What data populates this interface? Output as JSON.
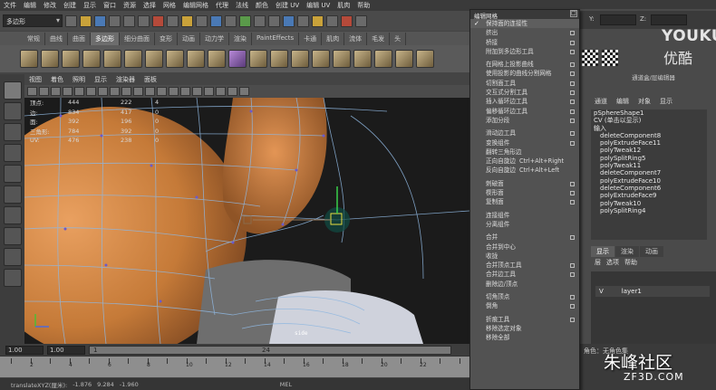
{
  "menubar": [
    "文件",
    "编辑",
    "修改",
    "创建",
    "显示",
    "窗口",
    "资源",
    "选择",
    "网格",
    "编辑网格",
    "代理",
    "法线",
    "颜色",
    "创建 UV",
    "编辑 UV",
    "肌肉",
    "帮助"
  ],
  "status_line": {
    "mode_select": "多边形"
  },
  "shelf_tabs": [
    "常规",
    "曲线",
    "曲面",
    "多边形",
    "细分曲面",
    "变形",
    "动画",
    "动力学",
    "渲染",
    "PaintEffects",
    "卡通",
    "肌肉",
    "流体",
    "毛发",
    "头"
  ],
  "active_shelf_tab": "多边形",
  "panel_menu": [
    "视图",
    "着色",
    "照明",
    "显示",
    "渲染器",
    "面板"
  ],
  "hud": {
    "rows": [
      {
        "label": "顶点:",
        "v1": "444",
        "v2": "222",
        "v3": "4"
      },
      {
        "label": "边:",
        "v1": "834",
        "v2": "417",
        "v3": "0"
      },
      {
        "label": "面:",
        "v1": "392",
        "v2": "196",
        "v3": "0"
      },
      {
        "label": "三角形:",
        "v1": "784",
        "v2": "392",
        "v3": "0"
      },
      {
        "label": "UV:",
        "v1": "476",
        "v2": "238",
        "v3": "0"
      }
    ]
  },
  "viewport_label": "side",
  "time_range": {
    "start1": "1.00",
    "start2": "1.00",
    "marker1": "1",
    "marker2": "24"
  },
  "timeline_ticks": [
    "2",
    "4",
    "6",
    "8",
    "10",
    "12",
    "14",
    "16",
    "18",
    "20",
    "22"
  ],
  "helpline": {
    "text": "translateXYZ(厘米):",
    "x": "-1.876",
    "y": "9.284",
    "z": "-1.960",
    "mel": "MEL"
  },
  "edit_mesh_menu": {
    "title": "编辑网格",
    "close": "□",
    "items": [
      {
        "label": "保持面的连接性",
        "check": "✓",
        "box": false
      },
      {
        "label": "挤出",
        "box": true
      },
      {
        "label": "桥接",
        "box": true
      },
      {
        "label": "附加到多边形工具",
        "box": true
      },
      {
        "sep": true
      },
      {
        "label": "在网格上投影曲线",
        "box": true
      },
      {
        "label": "使用投影的曲线分割网格",
        "box": true
      },
      {
        "label": "切割面工具",
        "box": true
      },
      {
        "label": "交互式分割工具",
        "box": true
      },
      {
        "label": "插入循环边工具",
        "box": true
      },
      {
        "label": "偏移循环边工具",
        "box": true
      },
      {
        "label": "添加分段",
        "box": true
      },
      {
        "sep": true
      },
      {
        "label": "滑动边工具",
        "box": true
      },
      {
        "label": "变换组件",
        "box": true
      },
      {
        "label": "翻转三角形边",
        "box": false
      },
      {
        "label": "正向自旋边",
        "shortcut": "Ctrl+Alt+Right",
        "box": false
      },
      {
        "label": "反向自旋边",
        "shortcut": "Ctrl+Alt+Left",
        "box": false
      },
      {
        "sep": true
      },
      {
        "label": "刺破面",
        "box": true
      },
      {
        "label": "楔形面",
        "box": true
      },
      {
        "label": "复制面",
        "box": true
      },
      {
        "sep": true
      },
      {
        "label": "连接组件",
        "box": false
      },
      {
        "label": "分离组件",
        "box": false
      },
      {
        "sep": true
      },
      {
        "label": "合并",
        "box": true
      },
      {
        "label": "合并到中心",
        "box": false
      },
      {
        "label": "收拢",
        "box": false
      },
      {
        "label": "合并顶点工具",
        "box": true
      },
      {
        "label": "合并边工具",
        "box": true
      },
      {
        "label": "删除边/顶点",
        "box": false
      },
      {
        "sep": true
      },
      {
        "label": "切角顶点",
        "box": true
      },
      {
        "label": "倒角",
        "box": true
      },
      {
        "sep": true
      },
      {
        "label": "折痕工具",
        "box": true
      },
      {
        "label": "移除选定对象",
        "box": false
      },
      {
        "label": "移除全部",
        "box": false
      }
    ]
  },
  "right_panel": {
    "coord_labels": {
      "y": "Y:",
      "z": "Z:"
    },
    "watermark_logo": "YOUKU",
    "watermark_cn": "优酷",
    "channel_header": "通道盒/层编辑器",
    "channel_menu": [
      "通道",
      "编辑",
      "对象",
      "显示"
    ],
    "object": "pSphereShape1",
    "cv_note": "CV (单击以显示)",
    "inputs_label": "输入",
    "history": [
      "deleteComponent8",
      "polyExtrudeFace11",
      "polyTweak12",
      "polySplitRing5",
      "polyTweak11",
      "deleteComponent7",
      "polyExtrudeFace10",
      "deleteComponent6",
      "polyExtrudeFace9",
      "polyTweak10",
      "polySplitRing4"
    ],
    "layer_tabs": [
      "显示",
      "渲染",
      "动画"
    ],
    "layer_menu": [
      "层",
      "选项",
      "帮助"
    ],
    "layer": {
      "vis": "V",
      "name": "layer1"
    },
    "bottom_watermark": "朱峰社区",
    "bottom_watermark_url": "ZF3D.COM",
    "bottom_label": "角色：无角色集"
  },
  "colors": {
    "menu_bg": "#525252",
    "viewport_bg": "#1c1c1c",
    "wire": "#8fb7e0",
    "mesh": "#d08a4a"
  }
}
